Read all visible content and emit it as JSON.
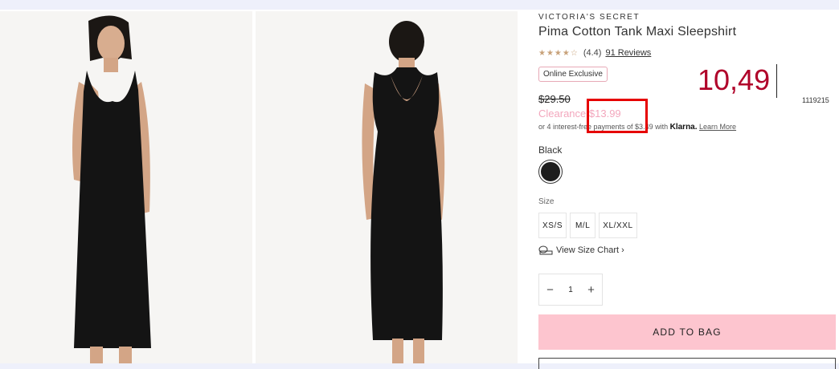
{
  "product": {
    "brand": "VICTORIA'S SECRET",
    "title": "Pima Cotton Tank Maxi Sleepshirt",
    "rating_stars": "★★★★☆",
    "rating_score": "(4.4)",
    "reviews_link": "91 Reviews",
    "badge": "Online Exclusive",
    "original_price": "$29.50",
    "sale_label": "Clearance",
    "sale_price": "$13.99",
    "installments_text": "or 4 interest-free payments of $3.49 with",
    "klarna_brand": "Klarna.",
    "learn_more": "Learn More",
    "color_name": "Black",
    "size_label": "Size",
    "sizes": [
      "XS/S",
      "M/L",
      "XL/XXL"
    ],
    "size_chart_label": "View Size Chart ›",
    "quantity": "1",
    "qty_minus": "−",
    "qty_plus": "+",
    "add_to_bag": "ADD TO BAG"
  },
  "overlay": {
    "typed_annotation": "10,49",
    "stray_text": "1119215"
  },
  "colors": {
    "sale_pink": "#f3a7bd",
    "bag_button": "#fdc5cf",
    "annotation_red": "#b0042a",
    "highlight_box": "#e60000",
    "swatch_black": "#1d1d1d"
  },
  "images": [
    {
      "icon": "product-photo-front"
    },
    {
      "icon": "product-photo-back"
    }
  ]
}
